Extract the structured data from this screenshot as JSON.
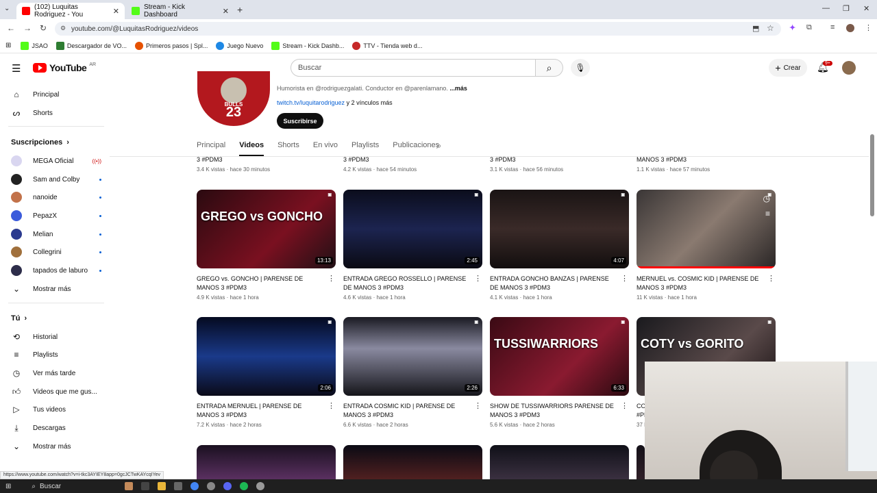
{
  "browser": {
    "tabs": [
      {
        "title": "(102) Luquitas Rodriguez - You",
        "favicon_color": "#ff0000",
        "active": true
      },
      {
        "title": "Stream - Kick Dashboard",
        "favicon_color": "#53fc18",
        "active": false
      }
    ],
    "url": "youtube.com/@LuquitasRodriguez/videos",
    "bookmarks": [
      {
        "label": "JSAO",
        "color": "#53fc18"
      },
      {
        "label": "Descargador de VO...",
        "color": "#2e7d32"
      },
      {
        "label": "Primeros pasos | Spl...",
        "color": "#e65100"
      },
      {
        "label": "Juego Nuevo",
        "color": "#1e88e5"
      },
      {
        "label": "Stream - Kick Dashb...",
        "color": "#53fc18"
      },
      {
        "label": "TTV - Tienda web d...",
        "color": "#c62828"
      }
    ]
  },
  "header": {
    "logo_text": "YouTube",
    "logo_country": "AR",
    "search_placeholder": "Buscar",
    "create_label": "Crear",
    "notifications_badge": "9+"
  },
  "sidebar": {
    "main": [
      {
        "label": "Principal",
        "icon": "home-icon"
      },
      {
        "label": "Shorts",
        "icon": "shorts-icon"
      }
    ],
    "subscriptions_title": "Suscripciones",
    "subscriptions": [
      {
        "label": "MEGA Oficial",
        "color": "#d9d6f0",
        "status": "live"
      },
      {
        "label": "Sam and Colby",
        "color": "#222222",
        "status": "dot"
      },
      {
        "label": "nanoide",
        "color": "#c2724a",
        "status": "dot"
      },
      {
        "label": "PepazX",
        "color": "#3b5bdb",
        "status": "dot"
      },
      {
        "label": "Melian",
        "color": "#2b3a8f",
        "status": "dot"
      },
      {
        "label": "Collegrini",
        "color": "#a0703c",
        "status": "dot"
      },
      {
        "label": "tapados de laburo",
        "color": "#2d2d4a",
        "status": "dot"
      }
    ],
    "show_more_1": "Mostrar más",
    "you_title": "Tú",
    "you_items": [
      {
        "label": "Historial",
        "icon": "history-icon"
      },
      {
        "label": "Playlists",
        "icon": "playlists-icon"
      },
      {
        "label": "Ver más tarde",
        "icon": "watch-later-icon"
      },
      {
        "label": "Videos que me gus...",
        "icon": "thumbs-up-icon"
      },
      {
        "label": "Tus videos",
        "icon": "your-videos-icon"
      },
      {
        "label": "Descargas",
        "icon": "download-icon"
      }
    ],
    "show_more_2": "Mostrar más"
  },
  "channel": {
    "avatar_text": "23",
    "avatar_team": "BULLS",
    "description": "Humorista en @rodriguezgalati. Conductor en @parenlamano.",
    "description_more": "...más",
    "link": "twitch.tv/luquitarodriguez",
    "link_suffix": " y 2 vínculos más",
    "subscribe_label": "Suscribirse",
    "tabs": [
      "Principal",
      "Videos",
      "Shorts",
      "En vivo",
      "Playlists",
      "Publicaciones"
    ],
    "active_tab": "Videos"
  },
  "prev_row": [
    {
      "title": "3 #PDM3",
      "meta": "3.4 K vistas · hace 30 minutos"
    },
    {
      "title": "3 #PDM3",
      "meta": "4.2 K vistas · hace 54 minutos"
    },
    {
      "title": "3 #PDM3",
      "meta": "3.1 K vistas · hace 56 minutos"
    },
    {
      "title": "MANOS 3 #PDM3",
      "meta": "1.1 K vistas · hace 57 minutos"
    }
  ],
  "videos": [
    {
      "title": "GREGO vs. GONCHO | PARENSE DE MANOS 3 #PDM3",
      "meta": "4.9 K vistas · hace 1 hora",
      "duration": "13:13",
      "thumb_text": "GREGO vs GONCHO",
      "bg": "linear-gradient(135deg,#2a0a10,#7a1020 60%,#201015)"
    },
    {
      "title": "ENTRADA GREGO ROSSELLO | PARENSE DE MANOS 3 #PDM3",
      "meta": "4.6 K vistas · hace 1 hora",
      "duration": "2:45",
      "thumb_text": "",
      "bg": "linear-gradient(180deg,#0b0d1c,#1c2450 50%,#0a0a12)"
    },
    {
      "title": "ENTRADA GONCHO BANZAS | PARENSE DE MANOS 3 #PDM3",
      "meta": "4.1 K vistas · hace 1 hora",
      "duration": "4:07",
      "thumb_text": "",
      "bg": "linear-gradient(180deg,#1a1414,#3a2a28 50%,#120e0e)"
    },
    {
      "title": "MERNUEL vs. COSMIC KID | PARENSE DE MANOS 3 #PDM3",
      "meta": "11 K vistas · hace 1 hora",
      "duration": "",
      "thumb_text": "",
      "bg": "linear-gradient(135deg,#3a3636,#8a7a70 50%,#2a2626)",
      "watched": true
    },
    {
      "title": "ENTRADA MERNUEL | PARENSE DE MANOS 3 #PDM3",
      "meta": "7.2 K vistas · hace 2 horas",
      "duration": "2:06",
      "thumb_text": "",
      "bg": "linear-gradient(180deg,#050a20,#1a3a8a 50%,#0a0a18)"
    },
    {
      "title": "ENTRADA COSMIC KID | PARENSE DE MANOS 3 #PDM3",
      "meta": "6.6 K vistas · hace 2 horas",
      "duration": "2:26",
      "thumb_text": "",
      "bg": "linear-gradient(180deg,#1a1a22,#8a8aa0 40%,#15151a)"
    },
    {
      "title": "SHOW DE TUSSIWARRIORS PARENSE DE MANOS 3 #PDM3",
      "meta": "5.6 K vistas · hace 2 horas",
      "duration": "6:33",
      "thumb_text": "TUSSIWARRIORS",
      "bg": "linear-gradient(135deg,#3a0a14,#8a1a30 60%,#2a0a10)"
    },
    {
      "title": "COTY vs. GORITO | PARENSE DE MANOS 3 #PDM3",
      "meta": "37 K vistas · hace 2 horas",
      "duration": "",
      "thumb_text": "COTY vs GORITO",
      "bg": "linear-gradient(135deg,#1a1a1e,#5a4a4a 60%,#1a1214)"
    }
  ],
  "next_row": [
    {
      "bg": "linear-gradient(180deg,#1a1020,#5a3060)"
    },
    {
      "bg": "linear-gradient(180deg,#0a0a14,#502020)"
    },
    {
      "bg": "linear-gradient(180deg,#101018,#3a3040)"
    },
    {
      "bg": "linear-gradient(180deg,#141018,#302028)"
    }
  ],
  "status_url": "https://www.youtube.com/watch?v=i-tkc3AYIEY8app=0gcJCTwKAYcqIYev",
  "taskbar": {
    "search_label": "Buscar"
  }
}
